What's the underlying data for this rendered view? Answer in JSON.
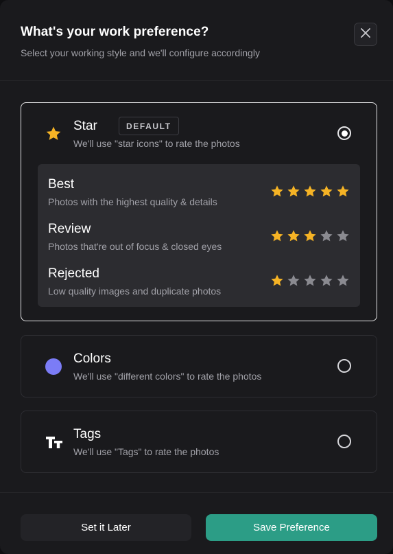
{
  "header": {
    "title": "What's your work preference?",
    "subtitle": "Select your working style and we'll configure accordingly",
    "close_icon": "close-icon"
  },
  "options": {
    "star": {
      "icon": "star-icon",
      "title": "Star",
      "badge": "DEFAULT",
      "description": "We'll use \"star icons\" to rate the photos",
      "selected": true,
      "ratings": [
        {
          "title": "Best",
          "description": "Photos with the highest quality & details",
          "stars": 5
        },
        {
          "title": "Review",
          "description": "Photos that're out of focus & closed eyes",
          "stars": 3
        },
        {
          "title": "Rejected",
          "description": "Low quality images and duplicate photos",
          "stars": 1
        }
      ],
      "max_stars": 5
    },
    "colors": {
      "icon": "color-dot-icon",
      "title": "Colors",
      "description": "We'll use \"different colors\" to rate the photos",
      "selected": false
    },
    "tags": {
      "icon": "text-tags-icon",
      "title": "Tags",
      "description": "We'll use \"Tags\" to rate the photos",
      "selected": false
    }
  },
  "footer": {
    "later_label": "Set it Later",
    "save_label": "Save Preference"
  },
  "colors": {
    "accent": "#2c9d86",
    "star_filled": "#f5b325",
    "star_empty": "#8a8a90",
    "color_dot": "#7b7cf6"
  }
}
